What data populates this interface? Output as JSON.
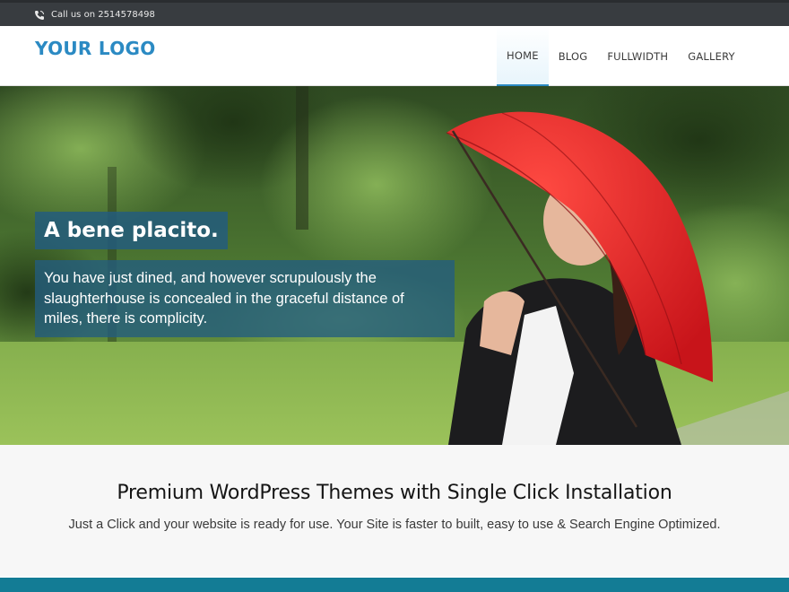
{
  "topbar": {
    "phone_icon": "phone-icon",
    "phone_text": "Call us on 2514578498"
  },
  "header": {
    "logo": "YOUR LOGO",
    "nav": [
      {
        "label": "HOME",
        "active": true
      },
      {
        "label": "BLOG",
        "active": false
      },
      {
        "label": "FULLWIDTH",
        "active": false
      },
      {
        "label": "GALLERY",
        "active": false
      }
    ]
  },
  "hero": {
    "title": "A bene placito.",
    "text": "You have just dined, and however scrupulously the slaughterhouse is concealed in the graceful distance of miles, there is complicity."
  },
  "intro": {
    "heading": "Premium WordPress Themes with Single Click Installation",
    "text": "Just a Click and your website is ready for use. Your Site is faster to built, easy to use & Search Engine Optimized."
  },
  "colors": {
    "accent": "#2b8ac3",
    "topbar": "#383c40",
    "caption_bg": "#225c80",
    "footer_bar": "#137c95"
  }
}
